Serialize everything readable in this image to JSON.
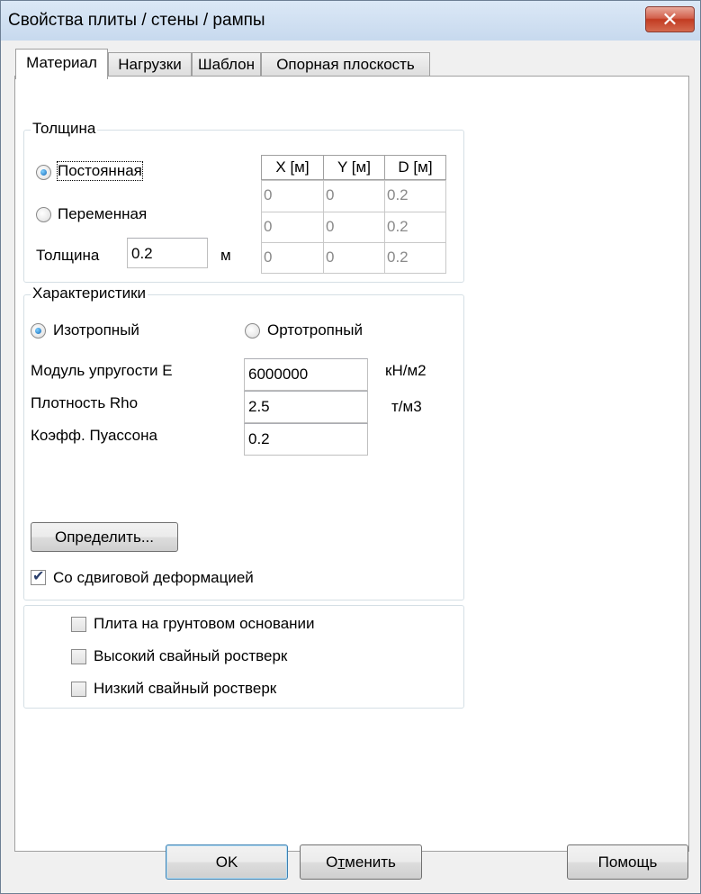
{
  "window": {
    "title": "Свойства плиты / стены  /  рампы",
    "close_symbol": "✕"
  },
  "tabs": [
    {
      "label": "Материал",
      "active": true
    },
    {
      "label": "Нагрузки",
      "active": false
    },
    {
      "label": "Шаблон",
      "active": false
    },
    {
      "label": "Опорная плоскость",
      "active": false
    }
  ],
  "thickness": {
    "legend": "Толщина",
    "constant_label": "Постоянная",
    "variable_label": "Переменная",
    "thickness_label": "Толщина",
    "thickness_value": "0.2",
    "unit": "м",
    "selected": "constant",
    "table": {
      "headers": [
        "X [м]",
        "Y [м]",
        "D [м]"
      ],
      "rows": [
        [
          "0",
          "0",
          "0.2"
        ],
        [
          "0",
          "0",
          "0.2"
        ],
        [
          "0",
          "0",
          "0.2"
        ]
      ]
    }
  },
  "characteristics": {
    "legend": "Характеристики",
    "isotropic_label": "Изотропный",
    "orthotropic_label": "Ортотропный",
    "selected": "isotropic",
    "modulus_label": "Модуль упругости E",
    "modulus_value": "6000000",
    "modulus_unit": "кН/м2",
    "density_label": "Плотность Rho",
    "density_value": "2.5",
    "density_unit": "т/м3",
    "poisson_label": "Коэфф. Пуассона",
    "poisson_value": "0.2",
    "define_button": "Определить...",
    "shear_label": "Со сдвиговой деформацией",
    "shear_checked": true
  },
  "options": [
    {
      "label": "Плита на грунтовом основании",
      "checked": false
    },
    {
      "label": "Высокий свайный ростверк",
      "checked": false
    },
    {
      "label": "Низкий свайный ростверк",
      "checked": false
    }
  ],
  "footer": {
    "ok": "OK",
    "cancel_pre": "О",
    "cancel_accel": "т",
    "cancel_post": "менить",
    "help": "Помощь"
  }
}
